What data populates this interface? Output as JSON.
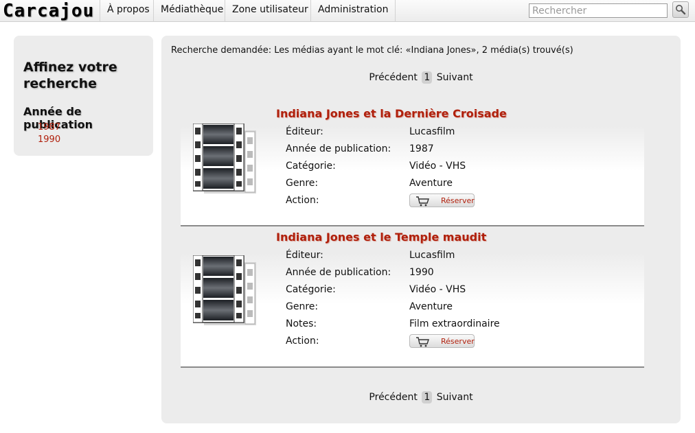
{
  "nav": {
    "brand": "Carcajou",
    "items": [
      "À propos",
      "Médiathèque",
      "Zone utilisateur",
      "Administration"
    ],
    "search_placeholder": "Rechercher"
  },
  "sidebar": {
    "title": "Affinez votre recherche",
    "subtitle": "Année de publication",
    "years": [
      "1987",
      "1990"
    ]
  },
  "results": {
    "summary": "Recherche demandée: Les médias ayant le mot clé: «Indiana Jones», 2 média(s) trouvé(s)",
    "pager": {
      "prev": "Précédent",
      "page": "1",
      "next": "Suivant"
    },
    "items": [
      {
        "title": "Indiana Jones et la Dernière Croisade",
        "fields": [
          {
            "label": "Éditeur:",
            "value": "Lucasfilm"
          },
          {
            "label": "Année de publication:",
            "value": "1987"
          },
          {
            "label": "Catégorie:",
            "value": "Vidéo - VHS"
          },
          {
            "label": "Genre:",
            "value": "Aventure"
          }
        ],
        "action_label": "Action:",
        "action_button": "Réserver"
      },
      {
        "title": "Indiana Jones et le Temple maudit",
        "fields": [
          {
            "label": "Éditeur:",
            "value": "Lucasfilm"
          },
          {
            "label": "Année de publication:",
            "value": "1990"
          },
          {
            "label": "Catégorie:",
            "value": "Vidéo - VHS"
          },
          {
            "label": "Genre:",
            "value": "Aventure"
          },
          {
            "label": "Notes:",
            "value": "Film extraordinaire"
          }
        ],
        "action_label": "Action:",
        "action_button": "Réserver"
      }
    ]
  },
  "icons": {
    "search": "magnifier-icon",
    "film": "film-reel-icon",
    "cart": "shopping-cart-icon"
  },
  "colors": {
    "accent": "#b0200c",
    "panel": "#ececec"
  }
}
